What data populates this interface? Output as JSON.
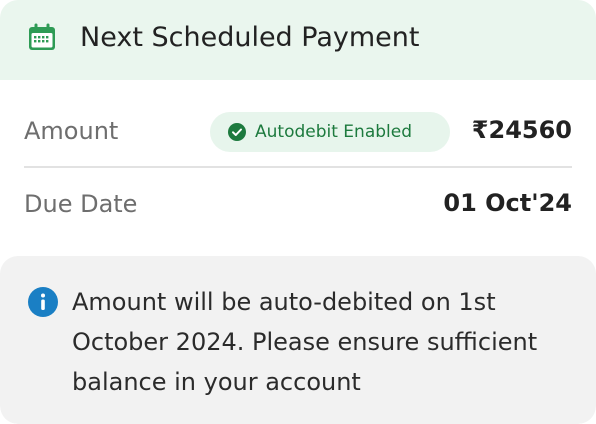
{
  "header": {
    "title": "Next Scheduled Payment",
    "icon": "calendar-icon"
  },
  "amount_row": {
    "label": "Amount",
    "badge": {
      "text": "Autodebit Enabled",
      "icon": "check-circle-icon",
      "color": "#1d7a3e"
    },
    "value": "₹24560"
  },
  "due_date_row": {
    "label": "Due Date",
    "value": "01 Oct'24"
  },
  "info": {
    "icon": "info-icon",
    "text": "Amount will be auto-debited on 1st October 2024. Please ensure sufficient balance in your account"
  },
  "colors": {
    "header_bg": "#eaf6ee",
    "accent_green": "#1d7a3e",
    "info_blue": "#1a7fc4",
    "info_bg": "#f2f2f2"
  }
}
